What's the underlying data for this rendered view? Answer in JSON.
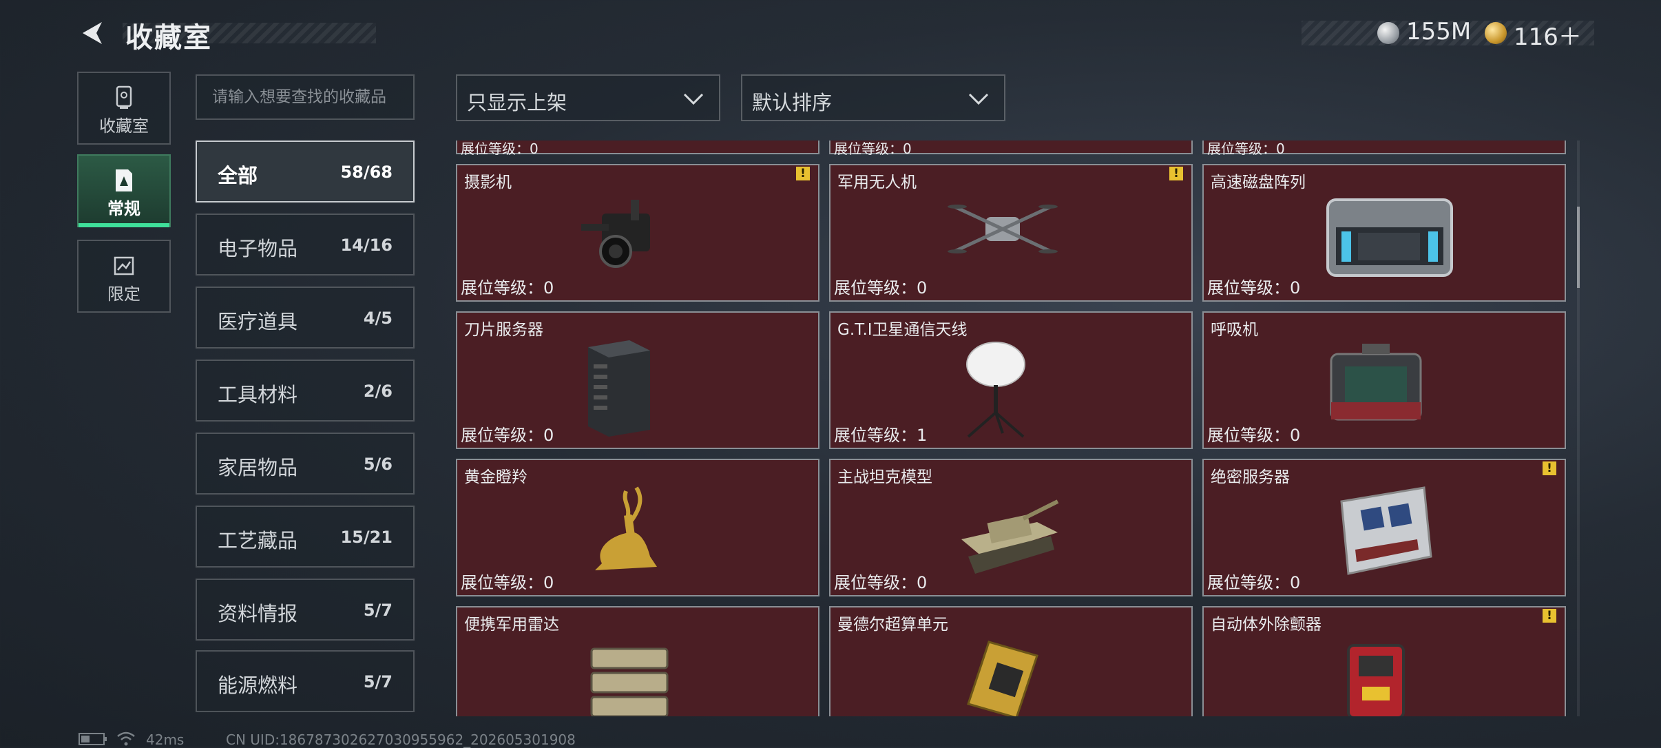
{
  "header": {
    "title": "收藏室"
  },
  "currency": {
    "silver": "155M",
    "gold": "116＋"
  },
  "nav": [
    {
      "label": "收藏室",
      "icon": "trophy-case-icon"
    },
    {
      "label": "常规",
      "icon": "card-icon"
    },
    {
      "label": "限定",
      "icon": "map-icon"
    }
  ],
  "search": {
    "placeholder": "请输入想要查找的收藏品"
  },
  "categories": [
    {
      "label": "全部",
      "count": "58/68"
    },
    {
      "label": "电子物品",
      "count": "14/16"
    },
    {
      "label": "医疗道具",
      "count": "4/5"
    },
    {
      "label": "工具材料",
      "count": "2/6"
    },
    {
      "label": "家居物品",
      "count": "5/6"
    },
    {
      "label": "工艺藏品",
      "count": "15/21"
    },
    {
      "label": "资料情报",
      "count": "5/7"
    },
    {
      "label": "能源燃料",
      "count": "5/7"
    }
  ],
  "filters": {
    "display": "只显示上架",
    "sort": "默认排序"
  },
  "level_label": "展位等级：",
  "partial_row": [
    "展位等级：0",
    "展位等级：0",
    "展位等级：0"
  ],
  "items": [
    {
      "name": "摄影机",
      "level": "0",
      "warn": true,
      "icon": "camera-icon"
    },
    {
      "name": "军用无人机",
      "level": "0",
      "warn": true,
      "icon": "drone-icon"
    },
    {
      "name": "高速磁盘阵列",
      "level": "0",
      "warn": false,
      "icon": "disk-array-icon"
    },
    {
      "name": "刀片服务器",
      "level": "0",
      "warn": false,
      "icon": "blade-server-icon"
    },
    {
      "name": "G.T.I卫星通信天线",
      "level": "1",
      "warn": false,
      "icon": "satellite-dish-icon"
    },
    {
      "name": "呼吸机",
      "level": "0",
      "warn": false,
      "icon": "ventilator-icon"
    },
    {
      "name": "黄金瞪羚",
      "level": "0",
      "warn": false,
      "icon": "golden-gazelle-icon"
    },
    {
      "name": "主战坦克模型",
      "level": "0",
      "warn": false,
      "icon": "tank-model-icon"
    },
    {
      "name": "绝密服务器",
      "level": "0",
      "warn": true,
      "icon": "secret-server-icon"
    },
    {
      "name": "便携军用雷达",
      "level": "",
      "warn": false,
      "icon": "radar-icon"
    },
    {
      "name": "曼德尔超算单元",
      "level": "",
      "warn": false,
      "icon": "cpu-unit-icon"
    },
    {
      "name": "自动体外除颤器",
      "level": "",
      "warn": true,
      "icon": "defibrillator-icon"
    }
  ],
  "status": {
    "ping": "42ms",
    "uid": "CN UID:18678730262703095596​2_202605301908"
  }
}
